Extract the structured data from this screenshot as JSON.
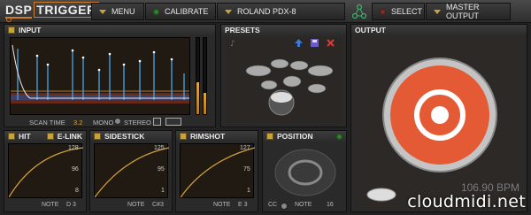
{
  "topbar": {
    "logo_line1": "DSP",
    "logo_line2": "TRIGGER",
    "menu_label": "MENU",
    "calibrate_label": "CALIBRATE",
    "kit_name": "ROLAND PDX-8",
    "select_label": "SELECT",
    "master_output_label": "MASTER OUTPUT"
  },
  "input": {
    "title": "INPUT",
    "scan_time_label": "SCAN TIME",
    "scan_time_value": "3.2",
    "mono_label": "MONO",
    "stereo_label": "STEREO",
    "meter_left_level": 0.42,
    "meter_right_level": 0.28
  },
  "presets": {
    "title": "PRESETS"
  },
  "output": {
    "title": "OUTPUT",
    "bpm": "106.90 BPM"
  },
  "hit": {
    "title": "HIT",
    "elink_label": "E-LINK",
    "max": "128",
    "mid": "96",
    "min": "8",
    "note_label": "NOTE",
    "note_value": "D 3"
  },
  "sidestick": {
    "title": "SIDESTICK",
    "max": "125",
    "mid": "95",
    "min": "1",
    "note_label": "NOTE",
    "note_value": "C#3"
  },
  "rimshot": {
    "title": "RIMSHOT",
    "max": "127",
    "mid": "75",
    "min": "1",
    "note_label": "NOTE",
    "note_value": "E 3"
  },
  "position": {
    "title": "POSITION",
    "cc_label": "CC",
    "note_label": "NOTE",
    "note_value": "16"
  },
  "watermark": "cloudmidi.net",
  "colors": {
    "accent": "#c9a23a",
    "pad_red": "#e45a34",
    "led_green": "#2f8a2f"
  }
}
